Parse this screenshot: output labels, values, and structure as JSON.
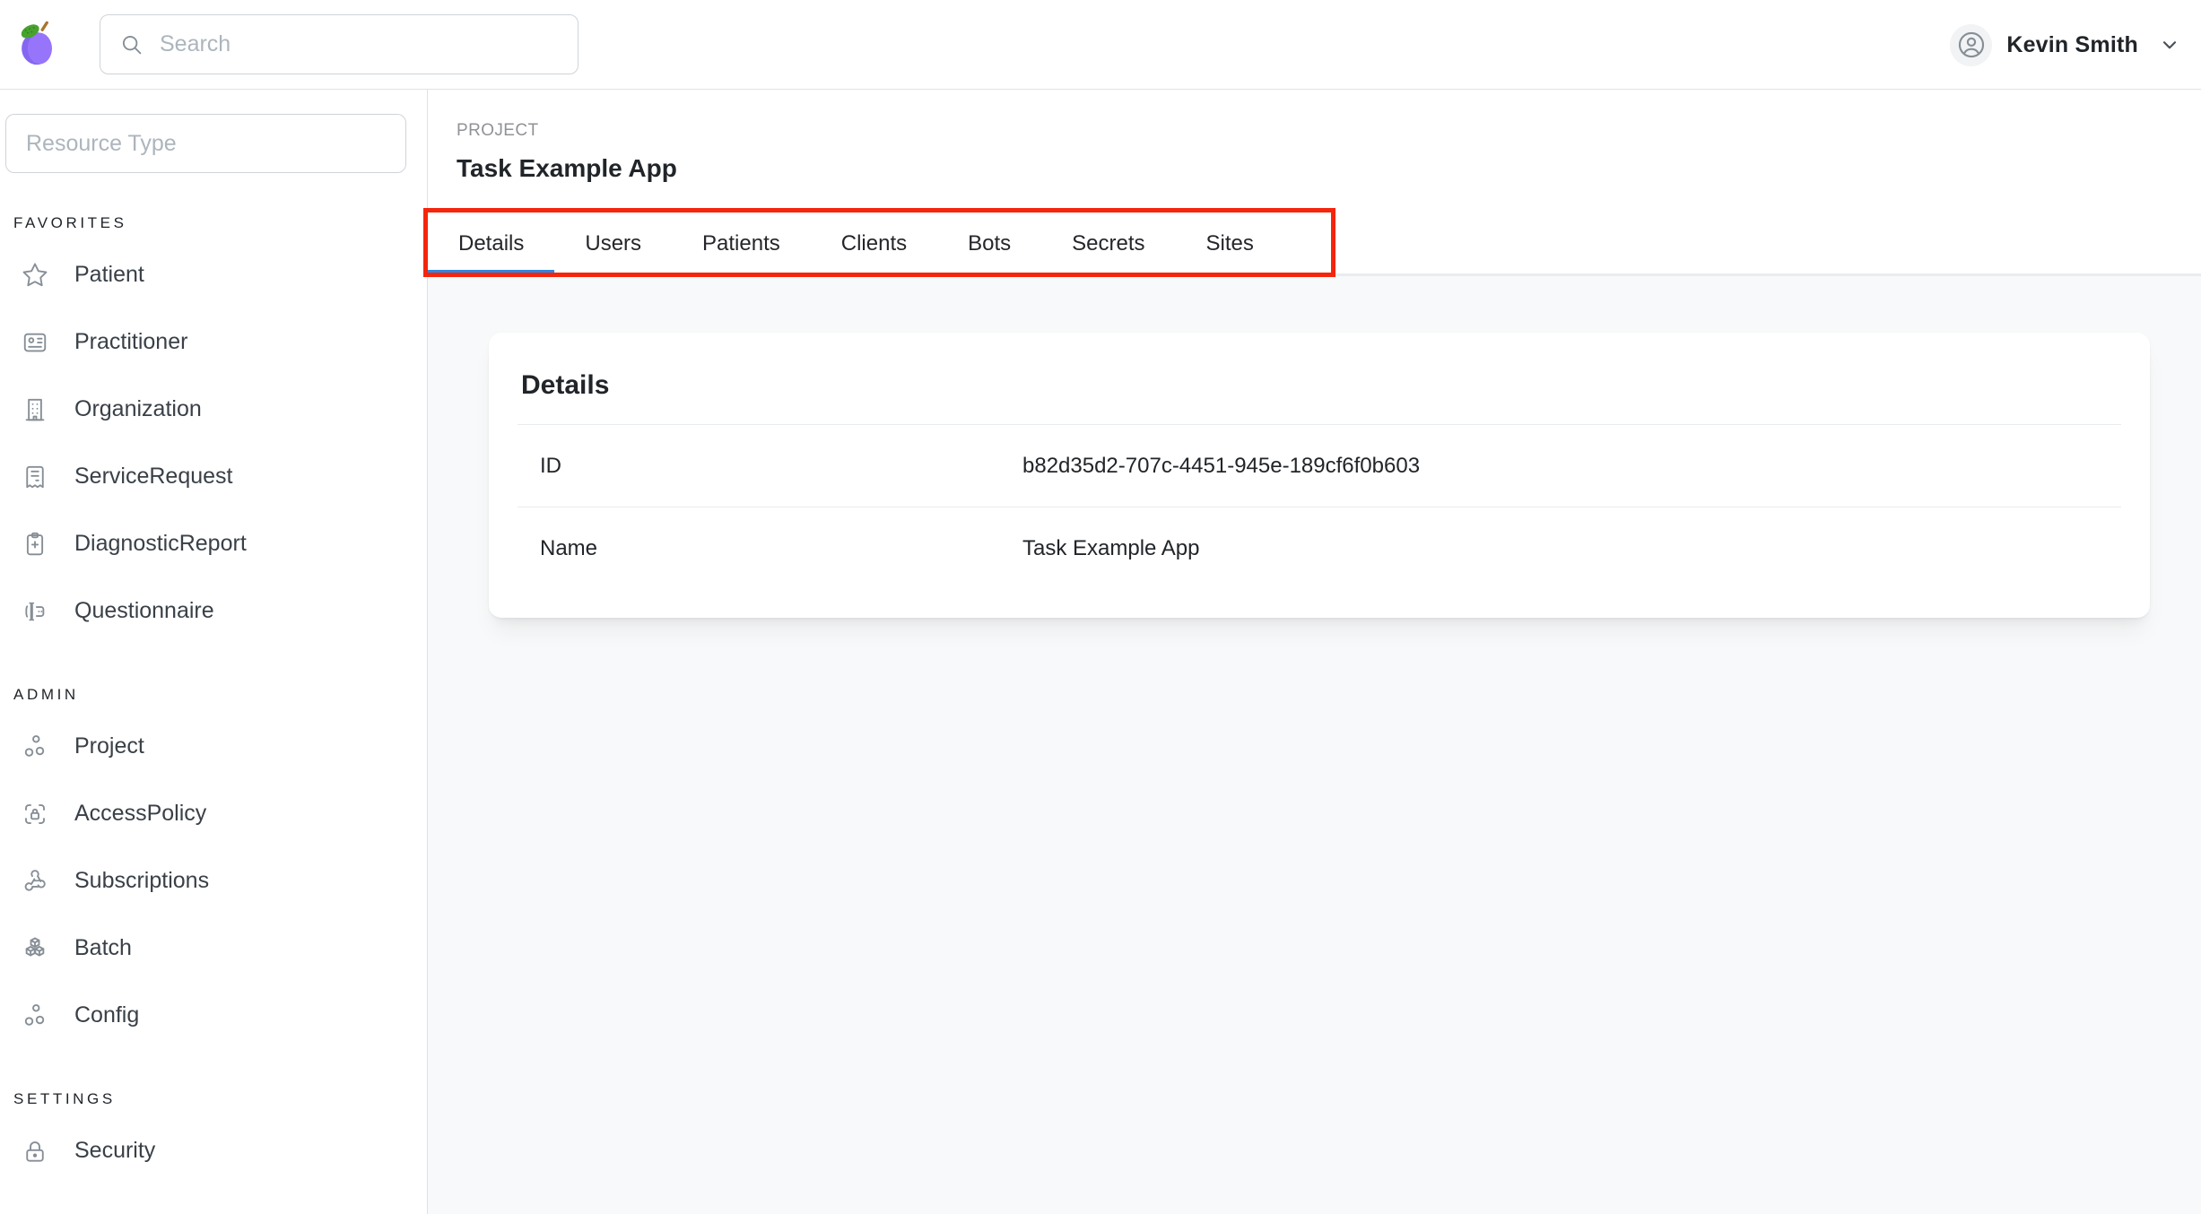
{
  "header": {
    "logo_icon": "plum-logo-icon",
    "search_placeholder": "Search",
    "user_name": "Kevin Smith",
    "user_menu_icons": [
      "user-avatar-icon",
      "chevron-down-icon"
    ]
  },
  "sidebar": {
    "filter_placeholder": "Resource Type",
    "sections": [
      {
        "label": "FAVORITES",
        "items": [
          {
            "icon": "star-icon",
            "label": "Patient"
          },
          {
            "icon": "id-card-icon",
            "label": "Practitioner"
          },
          {
            "icon": "building-icon",
            "label": "Organization"
          },
          {
            "icon": "receipt-icon",
            "label": "ServiceRequest"
          },
          {
            "icon": "report-medical-icon",
            "label": "DiagnosticReport"
          },
          {
            "icon": "forms-icon",
            "label": "Questionnaire"
          }
        ]
      },
      {
        "label": "ADMIN",
        "items": [
          {
            "icon": "hierarchy-icon",
            "label": "Project"
          },
          {
            "icon": "lock-brackets-icon",
            "label": "AccessPolicy"
          },
          {
            "icon": "webhook-icon",
            "label": "Subscriptions"
          },
          {
            "icon": "cubes-icon",
            "label": "Batch"
          },
          {
            "icon": "hierarchy-icon",
            "label": "Config"
          }
        ]
      },
      {
        "label": "SETTINGS",
        "items": [
          {
            "icon": "lock-icon",
            "label": "Security"
          }
        ]
      }
    ]
  },
  "main": {
    "eyebrow": "PROJECT",
    "title": "Task Example App",
    "tabs": [
      {
        "label": "Details",
        "active": true
      },
      {
        "label": "Users",
        "active": false
      },
      {
        "label": "Patients",
        "active": false
      },
      {
        "label": "Clients",
        "active": false
      },
      {
        "label": "Bots",
        "active": false
      },
      {
        "label": "Secrets",
        "active": false
      },
      {
        "label": "Sites",
        "active": false
      }
    ],
    "card": {
      "title": "Details",
      "rows": [
        {
          "label": "ID",
          "value": "b82d35d2-707c-4451-945e-189cf6f0b603"
        },
        {
          "label": "Name",
          "value": "Task Example App"
        }
      ]
    }
  },
  "colors": {
    "active_tab_indicator": "#2b87e3",
    "annotation_red": "#f5250c",
    "content_background": "#f8f9fa",
    "border_gray": "#dee2e6",
    "icon_gray": "#868e96"
  }
}
